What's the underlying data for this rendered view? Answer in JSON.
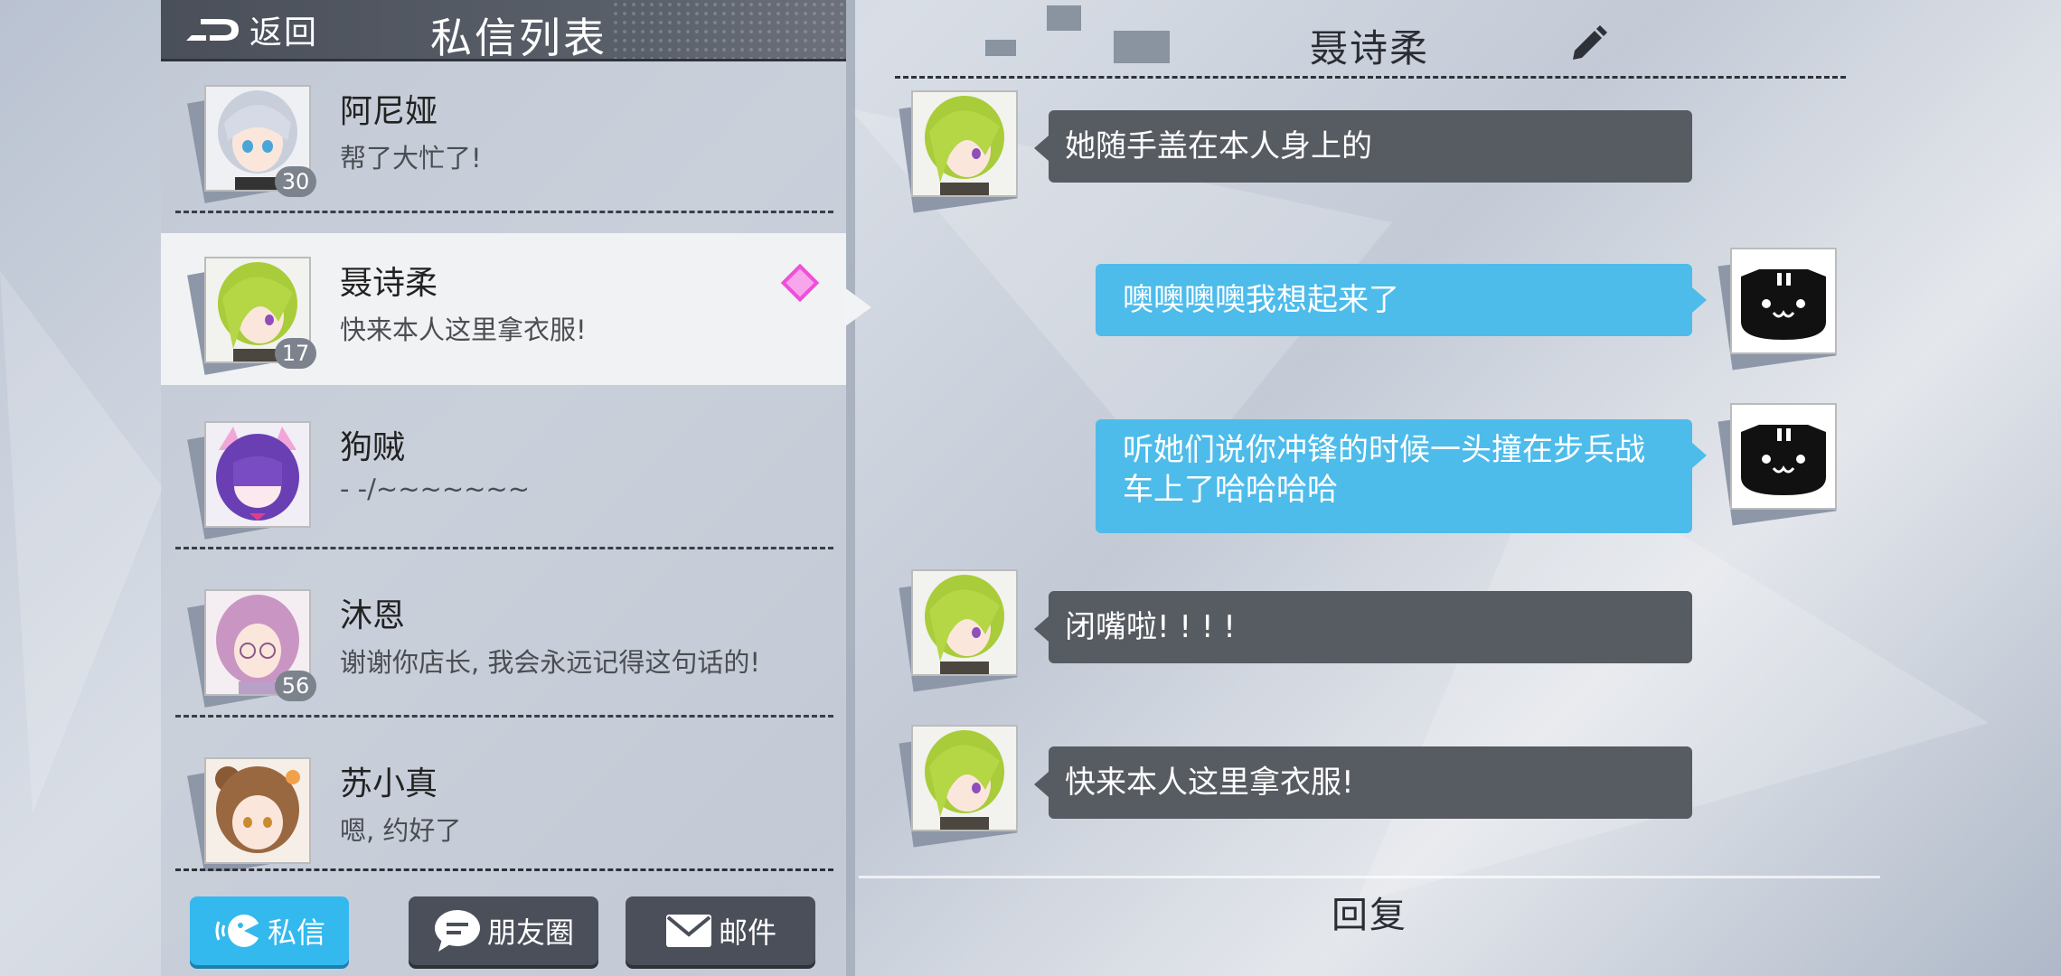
{
  "header": {
    "back_label": "返回",
    "title": "私信列表"
  },
  "contacts": [
    {
      "name": "阿尼娅",
      "message": "帮了大忙了!",
      "level": "30",
      "avatar": "silver-hair-girl"
    },
    {
      "name": "聂诗柔",
      "message": "快来本人这里拿衣服!",
      "level": "17",
      "avatar": "green-hair-girl",
      "selected": true
    },
    {
      "name": "狗贼",
      "message": "- -/~~~~~~~",
      "level": "",
      "avatar": "purple-hair-cat-ear-girl"
    },
    {
      "name": "沐恩",
      "message": "谢谢你店长, 我会永远记得这句话的!",
      "level": "56",
      "avatar": "pink-hair-glasses-girl"
    },
    {
      "name": "苏小真",
      "message": "嗯, 约好了",
      "level": "",
      "avatar": "brown-hair-girl"
    }
  ],
  "tabs": [
    {
      "label": "私信",
      "icon": "chat-bubble-icon",
      "active": true
    },
    {
      "label": "朋友圈",
      "icon": "moments-icon",
      "active": false
    },
    {
      "label": "邮件",
      "icon": "mail-icon",
      "active": false
    }
  ],
  "chat": {
    "title": "聂诗柔",
    "messages": [
      {
        "side": "left",
        "text": "她随手盖在本人身上的"
      },
      {
        "side": "right",
        "text": "噢噢噢噢我想起来了"
      },
      {
        "side": "right",
        "text": "听她们说你冲锋的时候一头撞在步兵战车上了哈哈哈哈"
      },
      {
        "side": "left",
        "text": "闭嘴啦! ! ! !"
      },
      {
        "side": "left",
        "text": "快来本人这里拿衣服!"
      }
    ],
    "reply_label": "回复"
  },
  "colors": {
    "accent_blue": "#34b9ee",
    "bubble_dark": "#575b62",
    "bubble_blue": "#4dbceb",
    "highlight_pink": "#f04fd6"
  }
}
